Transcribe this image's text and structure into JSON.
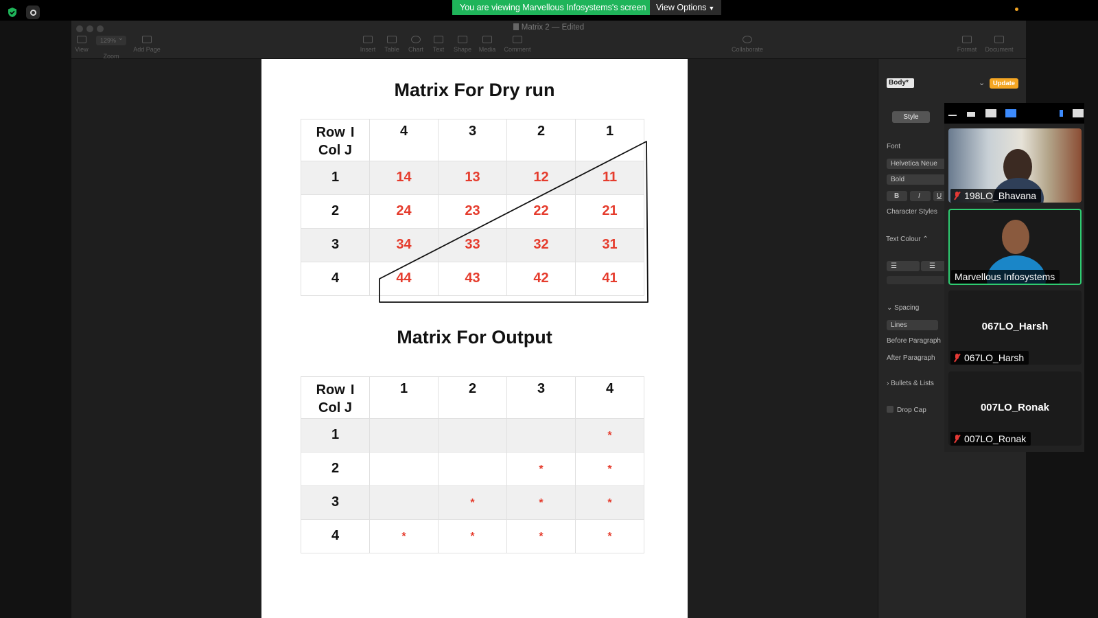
{
  "zoom": {
    "banner_text": "You are viewing Marvellous Infosystems's screen",
    "view_options_label": "View Options",
    "shield_color": "#1fb45a",
    "shield_icon": "shield-check-icon"
  },
  "pages": {
    "doc_title": "Matrix 2 — Edited",
    "zoom_level": "129%",
    "toolbar_left": [
      {
        "id": "view",
        "label": "View"
      },
      {
        "id": "zoom",
        "label": "Zoom"
      },
      {
        "id": "add-page",
        "label": "Add Page"
      }
    ],
    "toolbar_center": [
      {
        "id": "insert",
        "label": "Insert"
      },
      {
        "id": "table",
        "label": "Table"
      },
      {
        "id": "chart",
        "label": "Chart"
      },
      {
        "id": "text",
        "label": "Text"
      },
      {
        "id": "shape",
        "label": "Shape"
      },
      {
        "id": "media",
        "label": "Media"
      },
      {
        "id": "comment",
        "label": "Comment"
      }
    ],
    "collaborate_label": "Collaborate",
    "toolbar_right": [
      {
        "id": "format",
        "label": "Format"
      },
      {
        "id": "document",
        "label": "Document"
      }
    ]
  },
  "document": {
    "dry_run": {
      "title": "Matrix For Dry run",
      "corner_row": "Row",
      "corner_i": "I",
      "corner_col": "Col J",
      "headers": [
        "4",
        "3",
        "2",
        "1"
      ],
      "rows": [
        {
          "label": "1",
          "cells": [
            "14",
            "13",
            "12",
            "11"
          ]
        },
        {
          "label": "2",
          "cells": [
            "24",
            "23",
            "22",
            "21"
          ]
        },
        {
          "label": "3",
          "cells": [
            "34",
            "33",
            "32",
            "31"
          ]
        },
        {
          "label": "4",
          "cells": [
            "44",
            "43",
            "42",
            "41"
          ]
        }
      ]
    },
    "output": {
      "title": "Matrix For Output",
      "corner_row": "Row",
      "corner_i": "I",
      "corner_col": "Col J",
      "headers": [
        "1",
        "2",
        "3",
        "4"
      ],
      "rows": [
        {
          "label": "1",
          "cells": [
            "",
            "",
            "",
            "*"
          ]
        },
        {
          "label": "2",
          "cells": [
            "",
            "",
            "*",
            "*"
          ]
        },
        {
          "label": "3",
          "cells": [
            "",
            "*",
            "*",
            "*"
          ]
        },
        {
          "label": "4",
          "cells": [
            "*",
            "*",
            "*",
            "*"
          ]
        }
      ]
    },
    "highlight_color": "#e53b2c"
  },
  "inspector": {
    "paragraph_style": "Body*",
    "update_label": "Update",
    "style_tab": "Style",
    "font_label": "Font",
    "font_family": "Helvetica Neue",
    "font_weight": "Bold",
    "bold": "B",
    "italic": "I",
    "underline": "U",
    "character_styles_label": "Character Styles",
    "text_colour_label": "Text Colour ⌃",
    "spacing_label": "Spacing",
    "lines_value": "Lines",
    "before_paragraph_label": "Before Paragraph",
    "after_paragraph_label": "After Paragraph",
    "bullets_label": "Bullets & Lists",
    "drop_cap_label": "Drop Cap",
    "accent_color": "#f5a623"
  },
  "participants": [
    {
      "name": "198LO_Bhavana",
      "muted": true,
      "video": true
    },
    {
      "name": "Marvellous Infosystems",
      "muted": false,
      "video": true,
      "active_speaker": true
    },
    {
      "name": "067LO_Harsh",
      "muted": true,
      "video": false
    },
    {
      "name": "007LO_Ronak",
      "muted": true,
      "video": false
    }
  ]
}
